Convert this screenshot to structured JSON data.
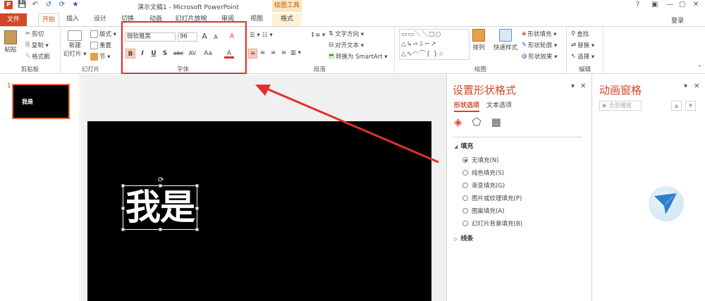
{
  "window": {
    "title": "演示文稿1 - Microsoft PowerPoint",
    "tool_context": "绘图工具",
    "login": "登录",
    "controls": [
      "?",
      "▣",
      "—",
      "▢",
      "✕"
    ]
  },
  "qat": {
    "app_icon": "P",
    "icons": [
      "save-icon",
      "undo-icon",
      "redo-icon",
      "start-from-beginning-icon",
      "star-icon"
    ]
  },
  "tabs": [
    "文件",
    "开始",
    "插入",
    "设计",
    "切换",
    "动画",
    "幻灯片放映",
    "审阅",
    "视图",
    "格式"
  ],
  "ribbon": {
    "clipboard": {
      "label": "剪贴板",
      "paste": "粘贴",
      "cut": "剪切",
      "copy": "复制 ▾",
      "format_painter": "格式刷"
    },
    "slides": {
      "label": "幻灯片",
      "new_slide": "新建",
      "new_slide2": "幻灯片 ▾",
      "layout": "版式 ▾",
      "reset": "重置",
      "section": "节 ▾"
    },
    "font": {
      "label": "字体",
      "font_name": "微软雅黑",
      "font_size": "96",
      "grow": "A",
      "shrink": "A",
      "clear": "A",
      "bold": "B",
      "italic": "I",
      "underline": "U",
      "shadow": "S",
      "strike": "abc",
      "spacing": "AV",
      "case": "Aa",
      "color": "A"
    },
    "paragraph": {
      "label": "段落",
      "text_direction": "文字方向 ▾",
      "align_text": "对齐文本 ▾",
      "smartart": "转换为 SmartArt ▾"
    },
    "drawing": {
      "label": "绘图",
      "arrange": "排列",
      "quick_styles": "快速样式",
      "fill": "形状填充 ▾",
      "outline": "形状轮廓 ▾",
      "effects": "形状效果 ▾"
    },
    "editing": {
      "label": "编辑",
      "find": "查找",
      "replace": "替换 ▾",
      "select": "选择 ▾"
    }
  },
  "thumbnail": {
    "number": "1",
    "text": "我是"
  },
  "slide": {
    "text": "我是"
  },
  "format_pane": {
    "title": "设置形状格式",
    "tab_shape": "形状选项",
    "tab_text": "文本选项",
    "fill_section": "填充",
    "fill_options": [
      {
        "label": "无填充(N)",
        "checked": true
      },
      {
        "label": "纯色填充(S)",
        "checked": false
      },
      {
        "label": "渐变填充(G)",
        "checked": false
      },
      {
        "label": "图片或纹理填充(P)",
        "checked": false
      },
      {
        "label": "图案填充(A)",
        "checked": false
      },
      {
        "label": "幻灯片背景填充(B)",
        "checked": false
      }
    ],
    "line_section": "线条"
  },
  "anim_pane": {
    "title": "动画窗格",
    "play_all": "▶ 全部播放"
  },
  "colors": {
    "accent": "#d24726",
    "highlight_box": "#e0302f"
  }
}
